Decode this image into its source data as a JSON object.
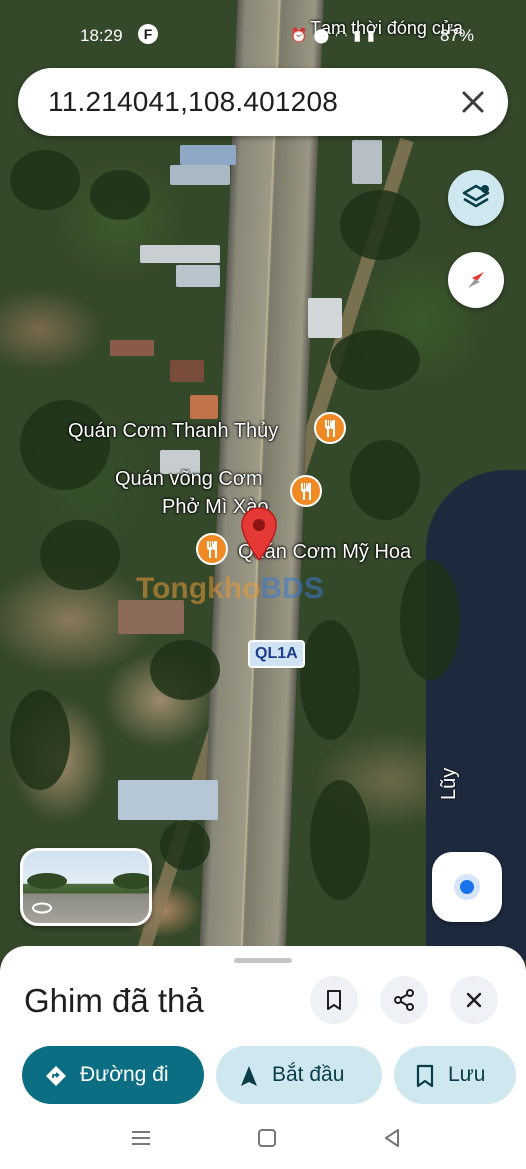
{
  "status_bar": {
    "time": "18:29",
    "app_icon": "F",
    "top_poi_text": "Tạm thời đóng cửa",
    "battery": "87%",
    "icons": [
      "alarm-icon",
      "location-icon",
      "wifi-icon",
      "signal-icon",
      "battery-icon"
    ]
  },
  "search": {
    "query": "11.214041,108.401208"
  },
  "map": {
    "places": [
      {
        "name": "Quán Cơm Thanh Thủy"
      },
      {
        "name": "Quán võng Cơm"
      },
      {
        "name": "Phở Mì Xào"
      },
      {
        "name": "Quán Cơm Mỹ Hoa"
      }
    ],
    "road_shield": "QL1A",
    "watermark_a": "Tongkho",
    "watermark_b": "BDS",
    "lake_label": "Lũy",
    "marker_color": "#e53935",
    "poi_color": "#f08a24"
  },
  "sheet": {
    "title": "Ghim đã thả",
    "directions_label": "Đường đi",
    "start_label": "Bắt đầu",
    "save_label": "Lưu"
  },
  "colors": {
    "primary_button": "#0b6e82",
    "tonal_button": "#cfe8ef"
  }
}
